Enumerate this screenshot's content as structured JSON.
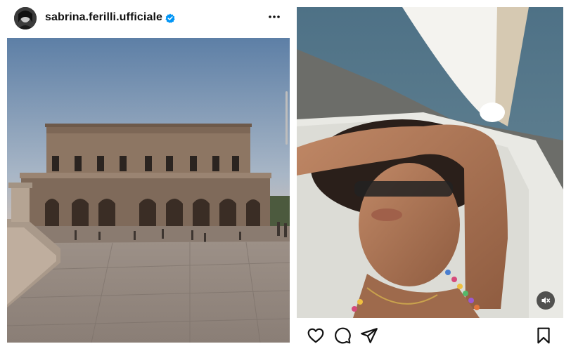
{
  "post": {
    "username": "sabrina.ferilli.ufficiale",
    "verified": true,
    "avatar_icon": "profile-photo",
    "more_icon": "more-horizontal-icon"
  },
  "media": {
    "left_image": "baroque-palace-photo",
    "right_video": "selfie-video-frame",
    "video_muted": true
  },
  "actions": {
    "icons": [
      "heart-icon",
      "comment-icon",
      "share-icon",
      "bookmark-icon"
    ]
  },
  "colors": {
    "verified_blue": "#0095f6",
    "text": "#111111",
    "mute_bg": "#1e1e1e"
  }
}
